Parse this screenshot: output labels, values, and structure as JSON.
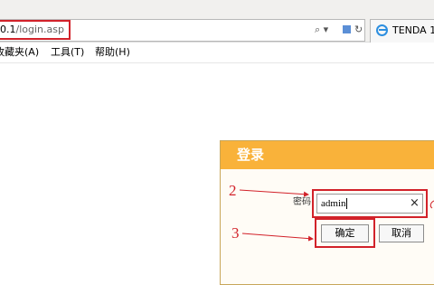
{
  "browser": {
    "url_host": "0.1",
    "url_path": "/login.asp",
    "search_glyph": "⌕ ▾",
    "refresh_glyph": "↻",
    "tab_title": "TENDA 1",
    "menu": [
      "收藏夹(A)",
      "工具(T)",
      "帮助(H)"
    ]
  },
  "login": {
    "title": "登录",
    "password_label": "密码",
    "password_value": "admin",
    "clear_symbol": "×",
    "ok_label": "确定",
    "cancel_label": "取消"
  },
  "annotations": {
    "step2": "2",
    "step3": "3",
    "color": "#d2222a"
  },
  "colors": {
    "panel_header": "#f9b23a",
    "highlight": "#d2222a"
  }
}
